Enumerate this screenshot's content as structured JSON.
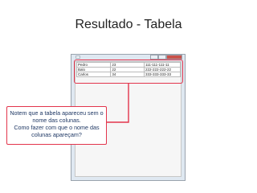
{
  "slide": {
    "title": "Resultado - Tabela"
  },
  "window": {
    "title": "",
    "controls": {
      "minimize": "",
      "maximize": "",
      "close": ""
    }
  },
  "table": {
    "rows": [
      [
        "Pedro",
        "23",
        "111-111-111-11"
      ],
      [
        "Balo",
        "22",
        "222-222-222-22"
      ],
      [
        "Carlos",
        "34",
        "333-333-333-33"
      ]
    ]
  },
  "callout": {
    "lines": [
      "Notem que a tabela apareceu sem o",
      "nome das colunas.",
      "Como fazer com que o nome das",
      "colunas apareçam?"
    ]
  },
  "colors": {
    "highlight": "#e3354c",
    "callout_text": "#1f3864"
  }
}
